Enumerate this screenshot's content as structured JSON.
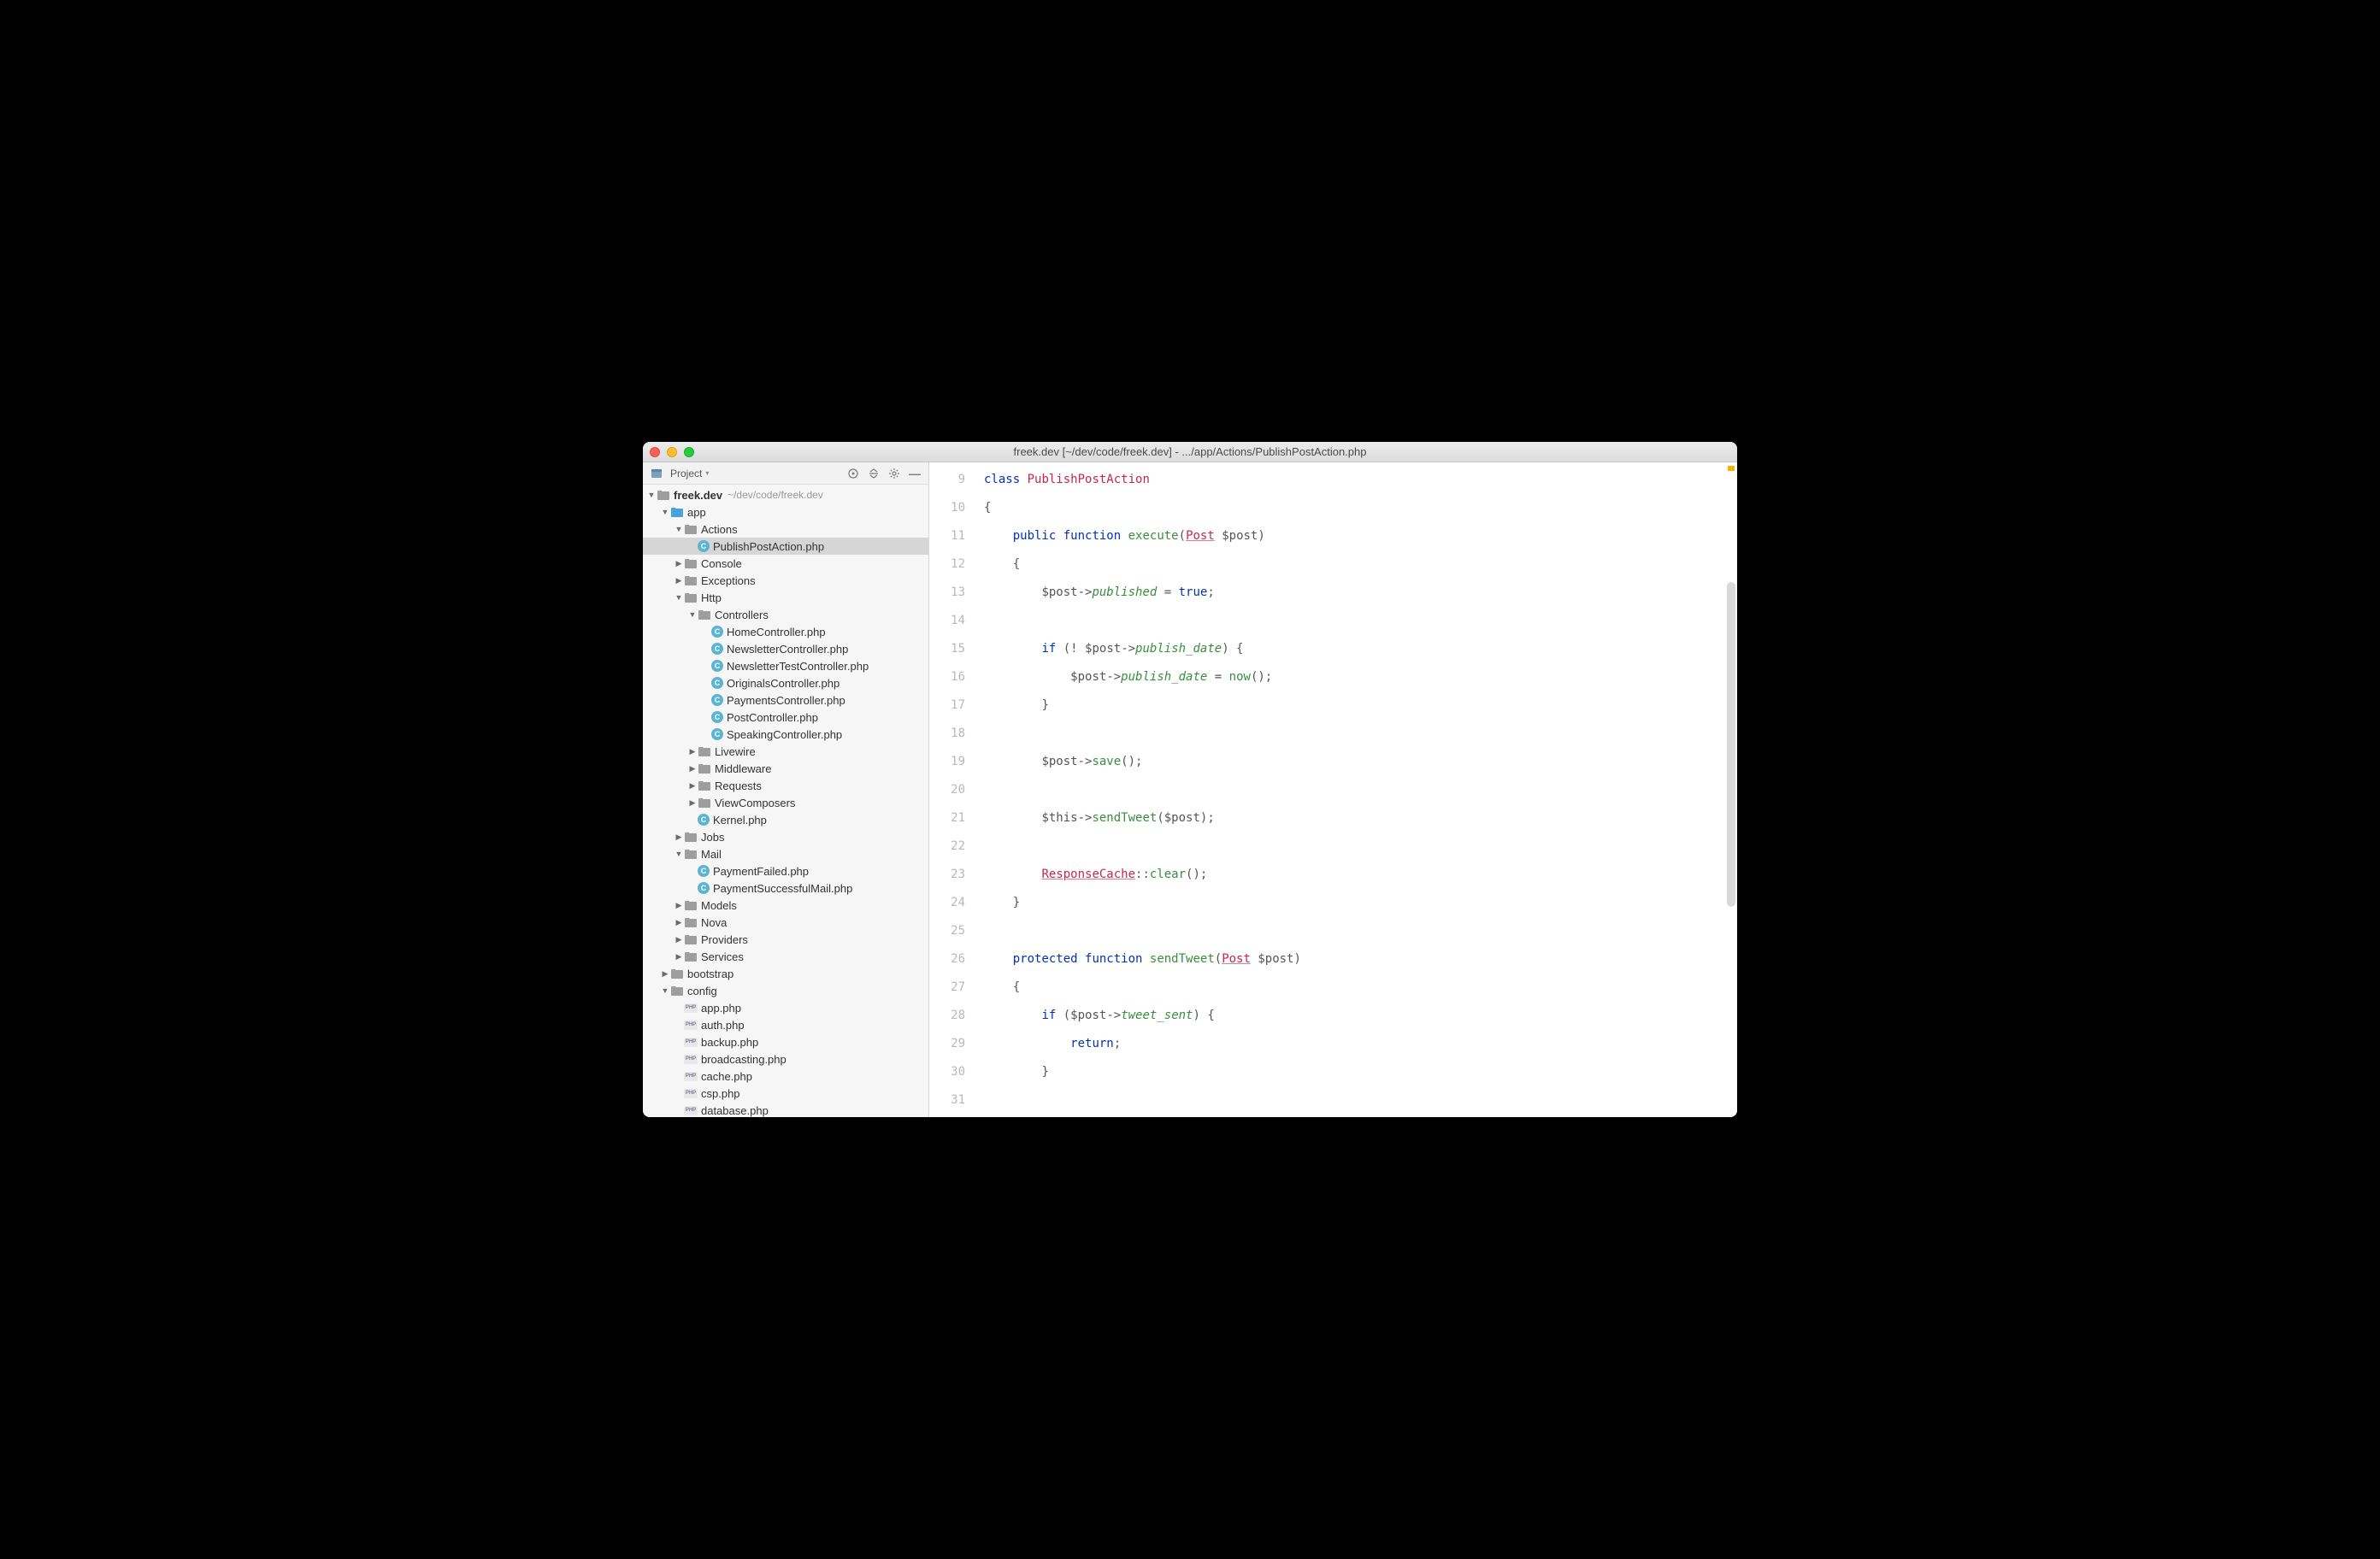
{
  "window": {
    "title": "freek.dev [~/dev/code/freek.dev] - .../app/Actions/PublishPostAction.php"
  },
  "sidebar": {
    "label": "Project",
    "root": {
      "name": "freek.dev",
      "hint": "~/dev/code/freek.dev"
    }
  },
  "tree": {
    "app": "app",
    "actions": "Actions",
    "publishpostaction": "PublishPostAction.php",
    "console": "Console",
    "exceptions": "Exceptions",
    "http": "Http",
    "controllers": "Controllers",
    "homecontroller": "HomeController.php",
    "newslettercontroller": "NewsletterController.php",
    "newslettertestcontroller": "NewsletterTestController.php",
    "originalscontroller": "OriginalsController.php",
    "paymentscontroller": "PaymentsController.php",
    "postcontroller": "PostController.php",
    "speakingcontroller": "SpeakingController.php",
    "livewire": "Livewire",
    "middleware": "Middleware",
    "requests": "Requests",
    "viewcomposers": "ViewComposers",
    "kernel": "Kernel.php",
    "jobs": "Jobs",
    "mail": "Mail",
    "paymentfailed": "PaymentFailed.php",
    "paymentsuccessfulmail": "PaymentSuccessfulMail.php",
    "models": "Models",
    "nova": "Nova",
    "providers": "Providers",
    "services": "Services",
    "bootstrap": "bootstrap",
    "config": "config",
    "cfg_app": "app.php",
    "cfg_auth": "auth.php",
    "cfg_backup": "backup.php",
    "cfg_broadcasting": "broadcasting.php",
    "cfg_cache": "cache.php",
    "cfg_csp": "csp.php",
    "cfg_database": "database.php"
  },
  "gutter": [
    "9",
    "10",
    "11",
    "12",
    "13",
    "14",
    "15",
    "16",
    "17",
    "18",
    "19",
    "20",
    "21",
    "22",
    "23",
    "24",
    "25",
    "26",
    "27",
    "28",
    "29",
    "30",
    "31"
  ],
  "code": {
    "class_kw": "class",
    "class_name": "PublishPostAction",
    "public_kw": "public",
    "function_kw": "function",
    "execute_fn": "execute",
    "post_type": "Post",
    "post_var": "$post",
    "published_prop": "published",
    "true_lit": "true",
    "if_kw": "if",
    "publish_date_prop": "publish_date",
    "now_fn": "now",
    "save_fn": "save",
    "this_var": "$this",
    "sendtweet_fn": "sendTweet",
    "responsecache": "ResponseCache",
    "clear_fn": "clear",
    "protected_kw": "protected",
    "sendtweet2_fn": "sendTweet",
    "tweet_sent_prop": "tweet_sent",
    "return_kw": "return"
  }
}
